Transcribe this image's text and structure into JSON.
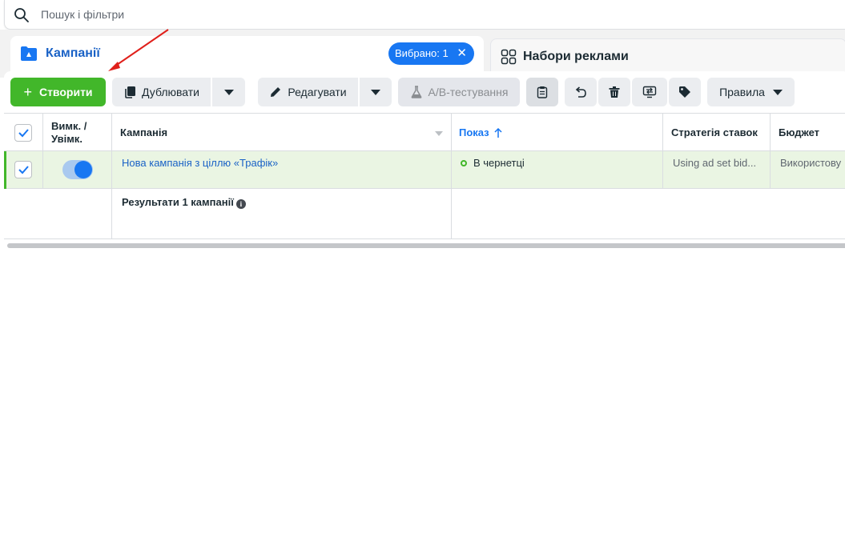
{
  "search": {
    "placeholder": "Пошук і фільтри"
  },
  "tabs": {
    "campaigns_label": "Кампанії",
    "selected_label": "Вибрано: 1",
    "ad_sets_label": "Набори реклами"
  },
  "toolbar": {
    "create_label": "Створити",
    "duplicate_label": "Дублювати",
    "edit_label": "Редагувати",
    "ab_test_label": "A/B-тестування",
    "rules_label": "Правила"
  },
  "table": {
    "headers": {
      "on_off": "Вимк. / Увімк.",
      "campaign": "Кампанія",
      "delivery": "Показ",
      "bid_strategy": "Стратегія ставок",
      "budget": "Бюджет"
    },
    "rows": [
      {
        "name": "Нова кампанія з ціллю «Трафік»",
        "delivery": "В чернетці",
        "bid_strategy": "Using ad set bid...",
        "budget": "Використову"
      }
    ],
    "results_label": "Результати 1 кампанії"
  },
  "colors": {
    "accent": "#1877f2",
    "create": "#42b72a",
    "selected_row": "#eaf5e3",
    "link": "#1a62c6",
    "annotation_arrow": "#e0201b"
  }
}
